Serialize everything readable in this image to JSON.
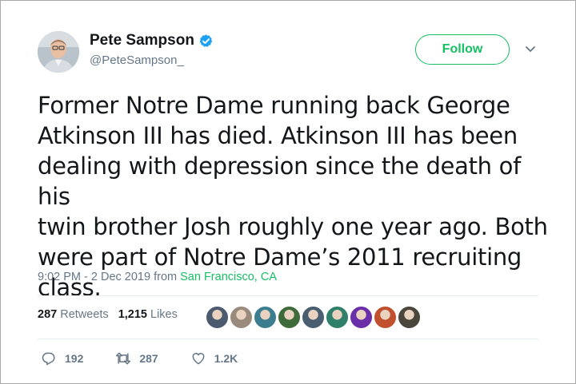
{
  "author": {
    "display_name": "Pete Sampson",
    "handle": "@PeteSampson_",
    "verified": true
  },
  "follow_label": "Follow",
  "tweet": {
    "text": "Former Notre Dame running back George\nAtkinson III has died. Atkinson III has been\ndealing with depression since the death of his\ntwin brother Josh roughly one year ago. Both\nwere part of Notre Dame’s 2011 recruiting\nclass."
  },
  "meta": {
    "timestamp": "9:02 PM - 2 Dec 2019",
    "from_label": "from",
    "location": "San Francisco, CA"
  },
  "stats": {
    "retweets_count": "287",
    "retweets_label": "Retweets",
    "likes_count": "1,215",
    "likes_label": "Likes"
  },
  "likers": [
    {
      "color": "#4b5a6e"
    },
    {
      "color": "#9a8a7c"
    },
    {
      "color": "#3c7d8f"
    },
    {
      "color": "#3f6b3a"
    },
    {
      "color": "#4a5e72"
    },
    {
      "color": "#2f7f6a"
    },
    {
      "color": "#6a2fa8"
    },
    {
      "color": "#c0502e"
    },
    {
      "color": "#4a463c"
    }
  ],
  "actions": {
    "replies": "192",
    "retweets": "287",
    "likes": "1.2K"
  },
  "colors": {
    "accent_green": "#17bf63",
    "verified_blue": "#1da1f2",
    "secondary_text": "#657786",
    "primary_text": "#14171a"
  }
}
